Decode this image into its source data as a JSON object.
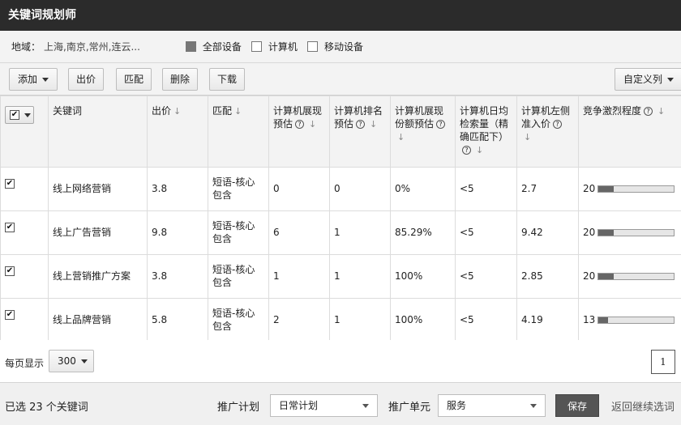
{
  "app": {
    "title": "关键词规划师"
  },
  "filters": {
    "region_label": "地域：",
    "region_value": "上海,南京,常州,连云...",
    "devices": [
      {
        "label": "全部设备",
        "state": "filled"
      },
      {
        "label": "计算机",
        "state": "unchecked"
      },
      {
        "label": "移动设备",
        "state": "unchecked"
      }
    ]
  },
  "toolbar": {
    "add_label": "添加",
    "bid_label": "出价",
    "match_label": "匹配",
    "delete_label": "删除",
    "download_label": "下载",
    "custom_cols_label": "自定义列"
  },
  "table": {
    "headers": {
      "keyword": "关键词",
      "bid": "出价",
      "match": "匹配",
      "impressions": "计算机展现预估",
      "rank": "计算机排名预估",
      "share": "计算机展现份额预估",
      "daily_search": "计算机日均检索量（精确匹配下）",
      "left_bid": "计算机左侧准入价",
      "competition": "竞争激烈程度"
    },
    "rows": [
      {
        "checked": true,
        "keyword": "线上网络营销",
        "bid": "3.8",
        "match": "短语-核心包含",
        "impressions": "0",
        "rank": "0",
        "share": "0%",
        "daily": "<5",
        "left_bid": "2.7",
        "competition": "20",
        "competition_level": 0.2
      },
      {
        "checked": true,
        "keyword": "线上广告营销",
        "bid": "9.8",
        "match": "短语-核心包含",
        "impressions": "6",
        "rank": "1",
        "share": "85.29%",
        "daily": "<5",
        "left_bid": "9.42",
        "competition": "20",
        "competition_level": 0.2
      },
      {
        "checked": true,
        "keyword": "线上营销推广方案",
        "bid": "3.8",
        "match": "短语-核心包含",
        "impressions": "1",
        "rank": "1",
        "share": "100%",
        "daily": "<5",
        "left_bid": "2.85",
        "competition": "20",
        "competition_level": 0.2
      },
      {
        "checked": true,
        "keyword": "线上品牌营销",
        "bid": "5.8",
        "match": "短语-核心包含",
        "impressions": "2",
        "rank": "1",
        "share": "100%",
        "daily": "<5",
        "left_bid": "4.19",
        "competition": "13",
        "competition_level": 0.13
      }
    ]
  },
  "pager": {
    "per_page_label": "每页显示",
    "per_page_value": "300",
    "page": "1"
  },
  "footer": {
    "selected_count": "已选 23 个关键词",
    "plan_label": "推广计划",
    "plan_value": "日常计划",
    "unit_label": "推广单元",
    "unit_value": "服务",
    "save_label": "保存",
    "back_label": "返回继续选词"
  },
  "icons": {
    "help": "question-circle-icon",
    "sort": "down-arrow-icon",
    "check": "checkbox-checked-icon"
  }
}
